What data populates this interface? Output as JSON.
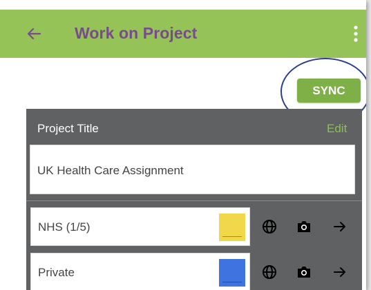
{
  "app_bar": {
    "title": "Work on Project",
    "back_icon": "arrow-left-icon",
    "menu_icon": "more-vert-icon",
    "color": "#95c357",
    "title_color": "#7a4a8e"
  },
  "sync_button": {
    "label": "SYNC",
    "color": "#7fb048"
  },
  "project_panel": {
    "header_label": "Project Title",
    "edit_label": "Edit",
    "title_value": "UK Health Care Assignment"
  },
  "sections": [
    {
      "label": "NHS (1/5)",
      "swatch_color": "#f0d84a",
      "icons": [
        "globe-icon",
        "camera-icon",
        "arrow-right-icon"
      ]
    },
    {
      "label": "Private",
      "swatch_color": "#3f73e0",
      "icons": [
        "globe-icon",
        "camera-icon",
        "arrow-right-icon"
      ]
    }
  ]
}
